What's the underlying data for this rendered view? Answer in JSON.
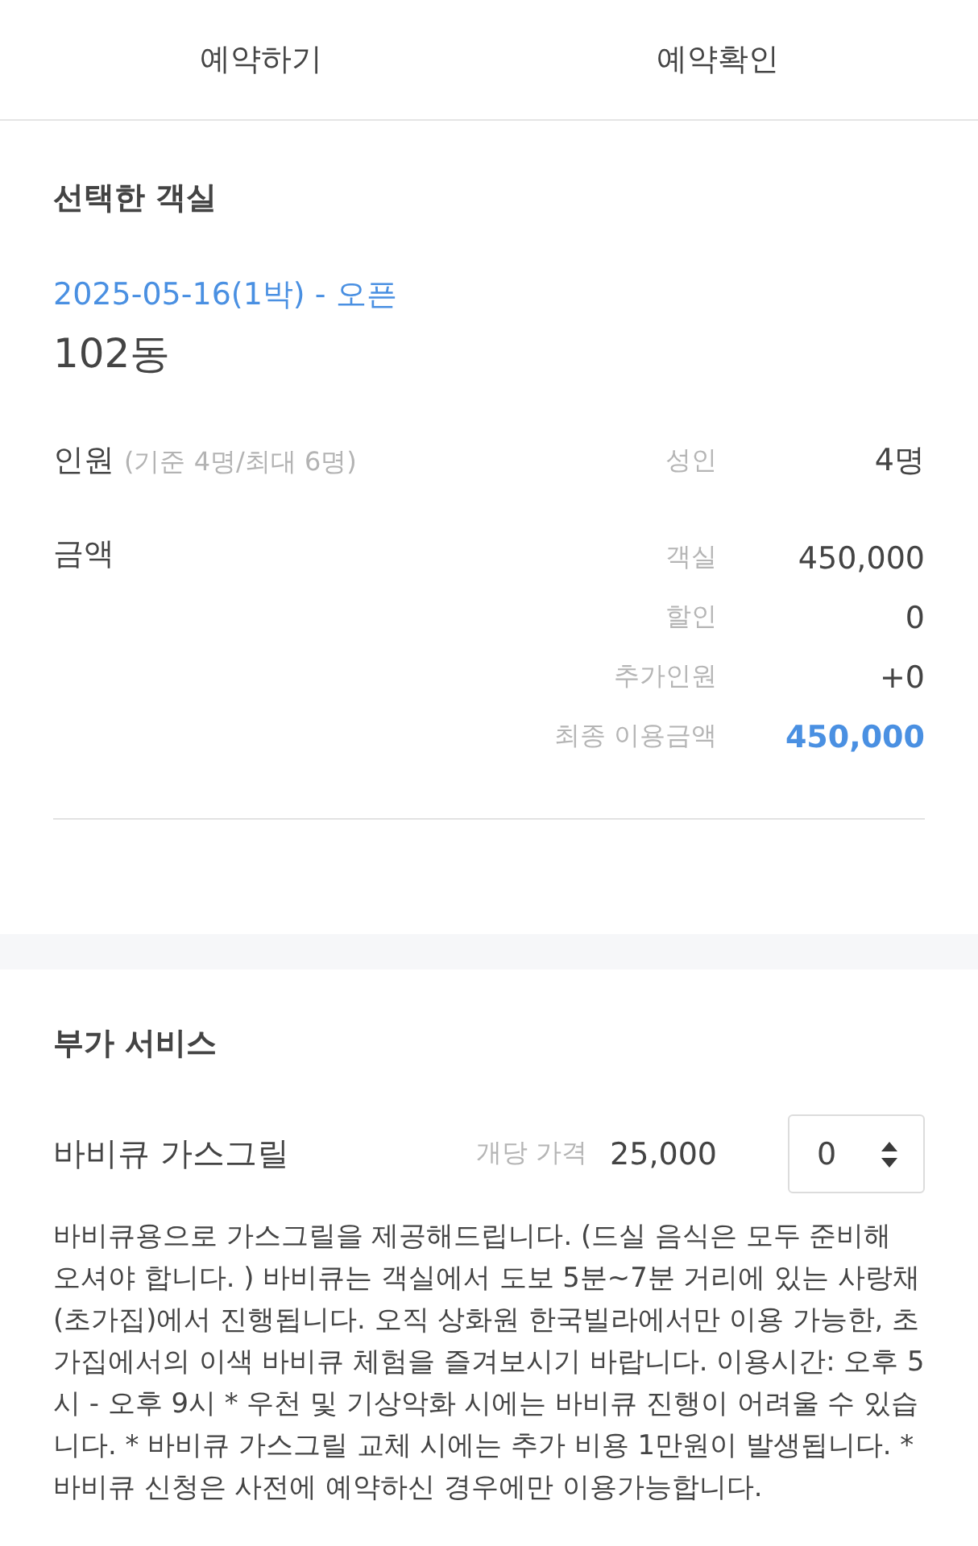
{
  "tabs": [
    {
      "label": "예약하기"
    },
    {
      "label": "예약확인"
    }
  ],
  "selected_room": {
    "title": "선택한 객실",
    "date": "2025-05-16(1박) - 오픈",
    "room": "102동",
    "guests": {
      "label": "인원",
      "note": "(기준 4명/최대 6명)",
      "rows": [
        {
          "label": "성인",
          "value": "4명"
        }
      ]
    },
    "price": {
      "label": "금액",
      "rows": [
        {
          "label": "객실",
          "value": "450,000",
          "kind": "plain"
        },
        {
          "label": "할인",
          "value": "0",
          "kind": "plain"
        },
        {
          "label": "추가인원",
          "value": "+0",
          "kind": "plain"
        },
        {
          "label": "최종 이용금액",
          "value": "450,000",
          "kind": "total"
        }
      ]
    }
  },
  "extra_services": {
    "title": "부가 서비스",
    "items": [
      {
        "name": "바비큐 가스그릴",
        "price_label": "개당 가격",
        "price": "25,000",
        "quantity": "0",
        "description": "바비큐용으로 가스그릴을 제공해드립니다. (드실 음식은 모두 준비해 오셔야 합니다. ) 바비큐는 객실에서 도보 5분~7분 거리에 있는 사랑채(초가집)에서 진행됩니다. 오직 상화원 한국빌라에서만 이용 가능한, 초가집에서의 이색 바비큐 체험을 즐겨보시기 바랍니다. 이용시간: 오후 5시 - 오후 9시 * 우천 및 기상악화 시에는 바비큐 진행이 어려울 수 있습니다. * 바비큐 가스그릴 교체 시에는 추가 비용 1만원이 발생됩니다. * 바비큐 신청은 사전에 예약하신 경우에만 이용가능합니다."
      }
    ]
  }
}
